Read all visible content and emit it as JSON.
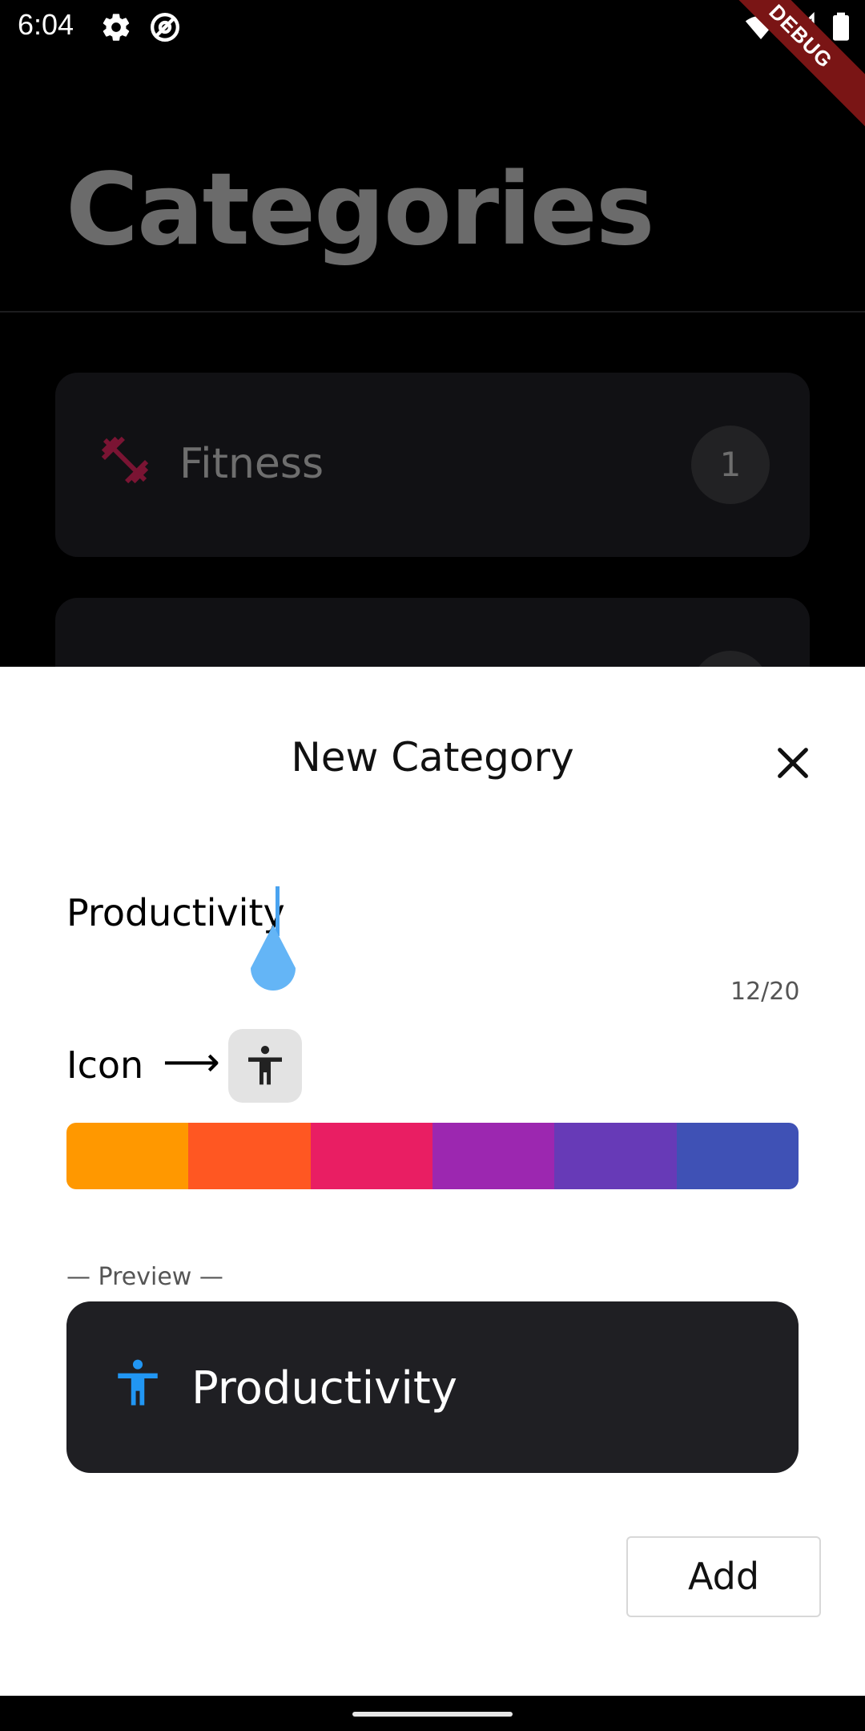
{
  "status_bar": {
    "time": "6:04",
    "icons": [
      "settings-icon",
      "at-sign-icon",
      "wifi-icon",
      "cell-signal-icon",
      "battery-icon"
    ],
    "debug_banner": "DEBUG"
  },
  "background": {
    "title": "Categories",
    "cards": [
      {
        "label": "Fitness",
        "count": "1",
        "icon": "dumbbell-icon",
        "icon_color": "#7a1433"
      },
      {
        "label": "",
        "count": "",
        "icon": "category-icon",
        "icon_color": "#b06a00"
      }
    ]
  },
  "sheet": {
    "title": "New Category",
    "name_field": {
      "value": "Productivity",
      "char_count": "12/20"
    },
    "icon_row": {
      "label": "Icon",
      "arrow": "⟶",
      "selected_icon": "accessibility-icon"
    },
    "palette": {
      "colors": [
        "#FF9800",
        "#FF5722",
        "#E91E63",
        "#9C27B0",
        "#673AB7",
        "#3F51B5"
      ]
    },
    "preview": {
      "label": "— Preview —",
      "name": "Productivity",
      "icon": "accessibility-icon",
      "icon_color": "#2196F3"
    },
    "add_button": "Add"
  }
}
